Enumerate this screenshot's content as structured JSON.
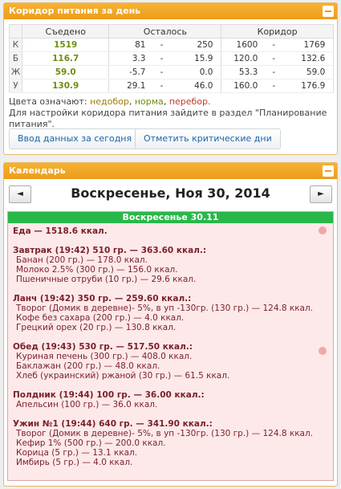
{
  "corridor": {
    "title": "Коридор питания за день",
    "headers": {
      "eaten": "Съедено",
      "left": "Осталось",
      "corridor": "Коридор"
    },
    "rows": [
      {
        "label": "К",
        "eaten": "1519",
        "left_min": "81",
        "left_max": "250",
        "cor_min": "1600",
        "cor_max": "1769"
      },
      {
        "label": "Б",
        "eaten": "116.7",
        "left_min": "3.3",
        "left_max": "15.9",
        "cor_min": "120.0",
        "cor_max": "132.6"
      },
      {
        "label": "Ж",
        "eaten": "59.0",
        "left_min": "-5.7",
        "left_max": "0.0",
        "cor_min": "53.3",
        "cor_max": "59.0"
      },
      {
        "label": "У",
        "eaten": "130.9",
        "left_min": "29.1",
        "left_max": "46.0",
        "cor_min": "160.0",
        "cor_max": "176.9"
      }
    ],
    "dash": "-",
    "legend_prefix": "Цвета означают: ",
    "legend_under": "недобор",
    "legend_norm": "норма",
    "legend_over": "перебор",
    "legend_sep": ", ",
    "legend_end": ".",
    "hint": "Для настройки коридора питания зайдите в раздел \"Планирование питания\".",
    "btn_enter": "Ввод данных за сегодня",
    "btn_mark": "Отметить критические дни"
  },
  "calendar": {
    "title": "Календарь",
    "prev": "◄",
    "next": "►",
    "date": "Воскресенье, Ноя 30, 2014",
    "day_header": "Воскресенье 30.11",
    "total": "Еда — 1518.6 ккал.",
    "meals": [
      {
        "title": "Завтрак (19:42) 510 гр. — 363.60 ккал.:",
        "items": [
          "Банан (200 гр.) — 178.0 ккал.",
          "Молоко 2.5% (300 гр.) — 156.0 ккал.",
          "Пшеничные отруби (10 гр.) — 29.6 ккал."
        ]
      },
      {
        "title": "Ланч (19:42) 350 гр. — 259.60 ккал.:",
        "items": [
          "Творог (Домик в деревне)- 5%, в уп -130гр. (130 гр.) — 124.8 ккал.",
          "Кофе без сахара (200 гр.) — 4.0 ккал.",
          "Грецкий орех (20 гр.) — 130.8 ккал."
        ]
      },
      {
        "title": "Обед (19:43) 530 гр. — 517.50 ккал.:",
        "items": [
          "Куриная печень (300 гр.) — 408.0 ккал.",
          "Баклажан (200 гр.) — 48.0 ккал.",
          "Хлеб (украинский) ржаной (30 гр.) — 61.5 ккал."
        ]
      },
      {
        "title": "Полдник (19:44) 100 гр. — 36.00 ккал.:",
        "items": [
          "Апельсин (100 гр.) — 36.0 ккал."
        ]
      },
      {
        "title": "Ужин №1 (19:44) 640 гр. — 341.90 ккал.:",
        "items": [
          "Творог (Домик в деревне)- 5%, в уп -130гр. (130 гр.) — 124.8 ккал.",
          "Кефир 1% (500 гр.) — 200.0 ккал.",
          "Корица (5 гр.) — 13.1 ккал.",
          "Имбирь (5 гр.) — 4.0 ккал."
        ]
      }
    ]
  }
}
